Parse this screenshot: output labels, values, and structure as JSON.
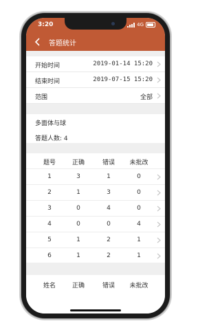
{
  "status": {
    "time": "3:20",
    "network": "4G"
  },
  "nav": {
    "title": "答题统计"
  },
  "info": [
    {
      "label": "开始时间",
      "value": "2019-01-14 15:20"
    },
    {
      "label": "结束时间",
      "value": "2019-07-15 15:20"
    },
    {
      "label": "范围",
      "value": "全部"
    }
  ],
  "question": {
    "title": "多面体与球",
    "count_label": "答题人数: 4"
  },
  "table1": {
    "headers": [
      "题号",
      "正确",
      "错误",
      "未批改"
    ],
    "rows": [
      [
        "1",
        "3",
        "1",
        "0"
      ],
      [
        "2",
        "1",
        "3",
        "0"
      ],
      [
        "3",
        "0",
        "4",
        "0"
      ],
      [
        "4",
        "0",
        "0",
        "4"
      ],
      [
        "5",
        "1",
        "2",
        "1"
      ],
      [
        "6",
        "1",
        "2",
        "1"
      ]
    ]
  },
  "table2": {
    "headers": [
      "姓名",
      "正确",
      "错误",
      "未批改"
    ]
  }
}
